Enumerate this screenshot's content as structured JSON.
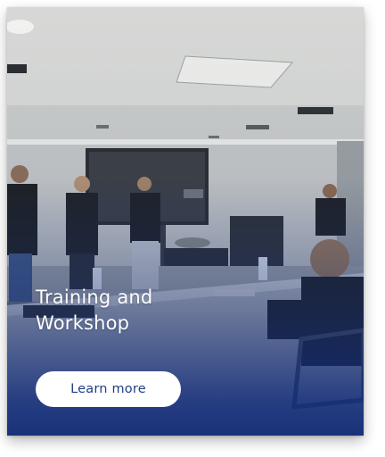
{
  "card": {
    "title": "Training and\nWorkshop",
    "cta_label": "Learn more",
    "image": "training-workshop-photo"
  },
  "colors": {
    "overlay": "#162d6e",
    "title_text": "#ffffff",
    "cta_background": "#ffffff",
    "cta_text": "#1d3f86"
  }
}
